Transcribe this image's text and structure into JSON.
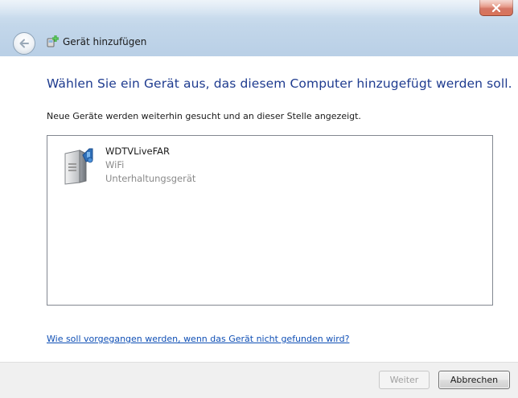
{
  "window": {
    "title": "Gerät hinzufügen",
    "close_symbol": "×"
  },
  "content": {
    "main_instruction": "Wählen Sie ein Gerät aus, das diesem Computer hinzugefügt werden soll.",
    "sub_text": "Neue Geräte werden weiterhin gesucht und an dieser Stelle angezeigt."
  },
  "devices": [
    {
      "name": "WDTVLiveFAR",
      "type": "WiFi",
      "category": "Unterhaltungsgerät",
      "icon": "media-device-icon"
    }
  ],
  "help_link": "Wie soll vorgegangen werden, wenn das Gerät nicht gefunden wird?",
  "footer": {
    "next_label": "Weiter",
    "cancel_label": "Abbrechen"
  },
  "colors": {
    "instruction": "#1e3b8f",
    "link": "#0f4fb5",
    "close_button": "#c2412a"
  }
}
